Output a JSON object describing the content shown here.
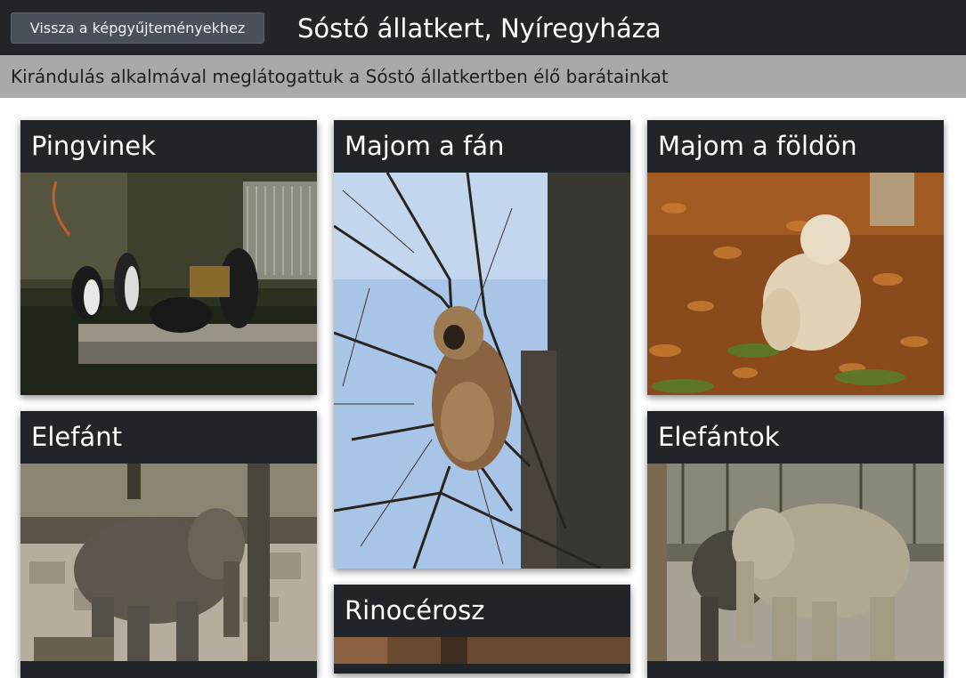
{
  "header": {
    "back_button_label": "Vissza a képgyűjteményekhez",
    "title": "Sóstó állatkert, Nyíregyháza"
  },
  "subheader": {
    "text": "Kirándulás alkalmával meglátogattuk a Sóstó állatkertben élő barátainkat"
  },
  "gallery": {
    "cards": [
      {
        "title": "Pingvinek"
      },
      {
        "title": "Majom a fán"
      },
      {
        "title": "Majom a földön"
      },
      {
        "title": "Elefánt"
      },
      {
        "title": "Rinocérosz"
      },
      {
        "title": "Elefántok"
      }
    ]
  }
}
